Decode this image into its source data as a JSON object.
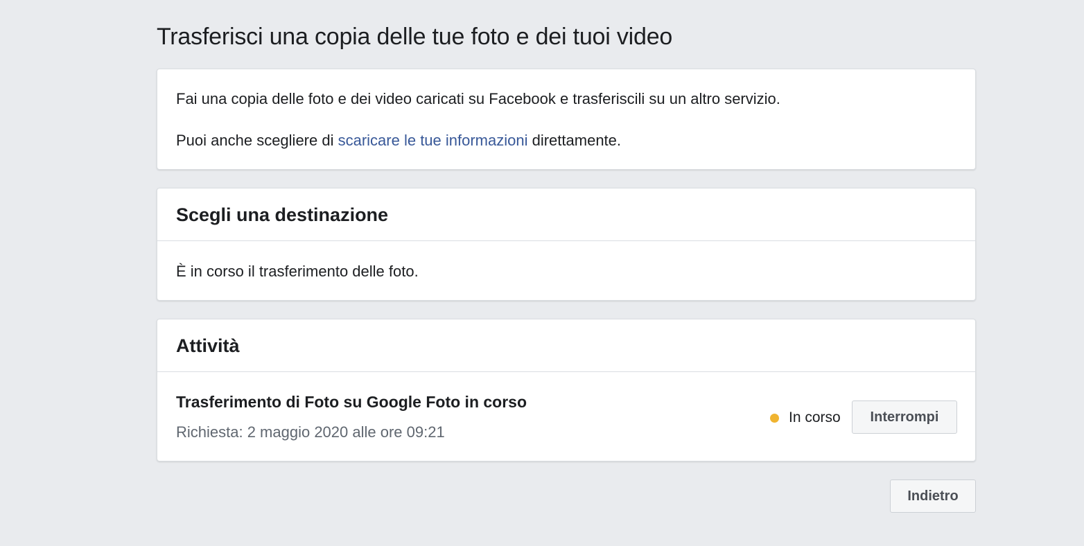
{
  "page": {
    "title": "Trasferisci una copia delle tue foto e dei tuoi video"
  },
  "intro": {
    "line1": "Fai una copia delle foto e dei video caricati su Facebook e trasferiscili su un altro servizio.",
    "line2_prefix": "Puoi anche scegliere di ",
    "line2_link": "scaricare le tue informazioni",
    "line2_suffix": " direttamente."
  },
  "destination": {
    "heading": "Scegli una destinazione",
    "status": "È in corso il trasferimento delle foto."
  },
  "activity": {
    "heading": "Attività",
    "items": [
      {
        "title": "Trasferimento di Foto su Google Foto in corso",
        "requested": "Richiesta: 2 maggio 2020 alle ore 09:21",
        "status_label": "In corso",
        "status_color": "#f0b430",
        "status_icon": "status-dot-icon",
        "action_label": "Interrompi"
      }
    ]
  },
  "footer": {
    "back_label": "Indietro"
  },
  "colors": {
    "background": "#e9ebee",
    "link": "#385898",
    "text": "#1c1e21",
    "secondary_text": "#606770"
  }
}
